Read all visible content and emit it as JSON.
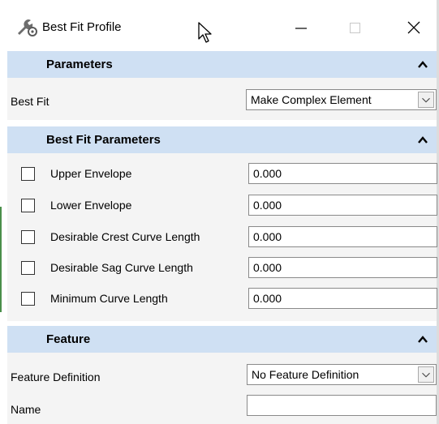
{
  "window": {
    "title": "Best Fit Profile",
    "icon": "wrench-gear-icon"
  },
  "sections": {
    "parameters": {
      "title": "Parameters",
      "best_fit_label": "Best Fit",
      "best_fit_value": "Make Complex Element"
    },
    "best_fit_parameters": {
      "title": "Best Fit Parameters",
      "rows": [
        {
          "label": "Upper Envelope",
          "value": "0.000",
          "checked": false
        },
        {
          "label": "Lower Envelope",
          "value": "0.000",
          "checked": false
        },
        {
          "label": "Desirable Crest Curve Length",
          "value": "0.000",
          "checked": false
        },
        {
          "label": "Desirable Sag Curve Length",
          "value": "0.000",
          "checked": false
        },
        {
          "label": "Minimum Curve Length",
          "value": "0.000",
          "checked": false
        }
      ]
    },
    "feature": {
      "title": "Feature",
      "feature_definition_label": "Feature Definition",
      "feature_definition_value": "No Feature Definition",
      "name_label": "Name",
      "name_value": ""
    }
  },
  "colors": {
    "section_header": "#cfe0f3",
    "section_body": "#f4f4f4"
  }
}
